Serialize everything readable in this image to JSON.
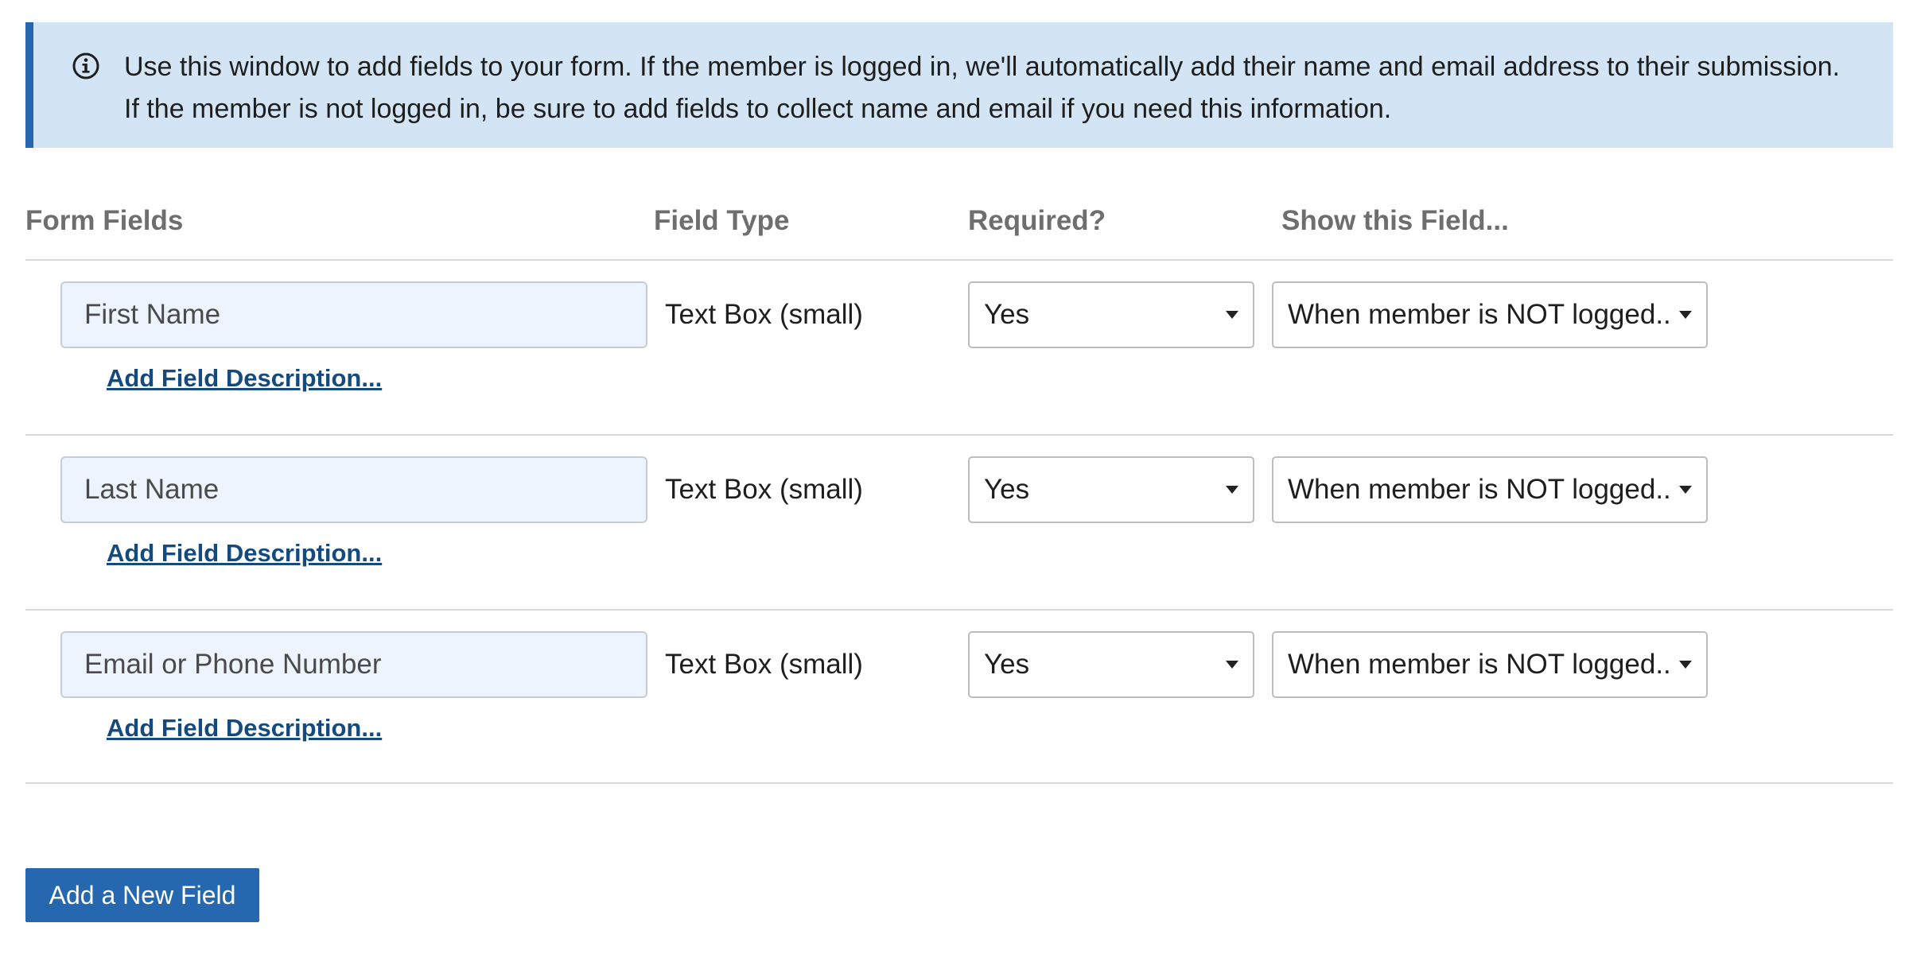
{
  "banner": {
    "icon": "info-circle-icon",
    "line1": "Use this window to add fields to your form. If the member is logged in, we'll automatically add their name and email address to their submission.",
    "line2": "If the member is not logged in, be sure to add fields to collect name and email if you need this information.",
    "background": "#d3e5f5",
    "accent": "#2668b0"
  },
  "headers": {
    "form_fields": "Form Fields",
    "field_type": "Field Type",
    "required": "Required?",
    "show_field": "Show this Field..."
  },
  "fields": [
    {
      "name": "First Name",
      "type": "Text Box (small)",
      "required": "Yes",
      "show": "When member is NOT logged...",
      "description_link": "Add Field Description..."
    },
    {
      "name": "Last Name",
      "type": "Text Box (small)",
      "required": "Yes",
      "show": "When member is NOT logged...",
      "description_link": "Add Field Description..."
    },
    {
      "name": "Email or Phone Number",
      "type": "Text Box (small)",
      "required": "Yes",
      "show": "When member is NOT logged...",
      "description_link": "Add Field Description..."
    }
  ],
  "add_button": {
    "label": "Add a New Field",
    "color": "#2668b0"
  },
  "colors": {
    "link": "#154a7e",
    "header_text": "#6e6e6e",
    "input_bg": "#edf4fd"
  }
}
